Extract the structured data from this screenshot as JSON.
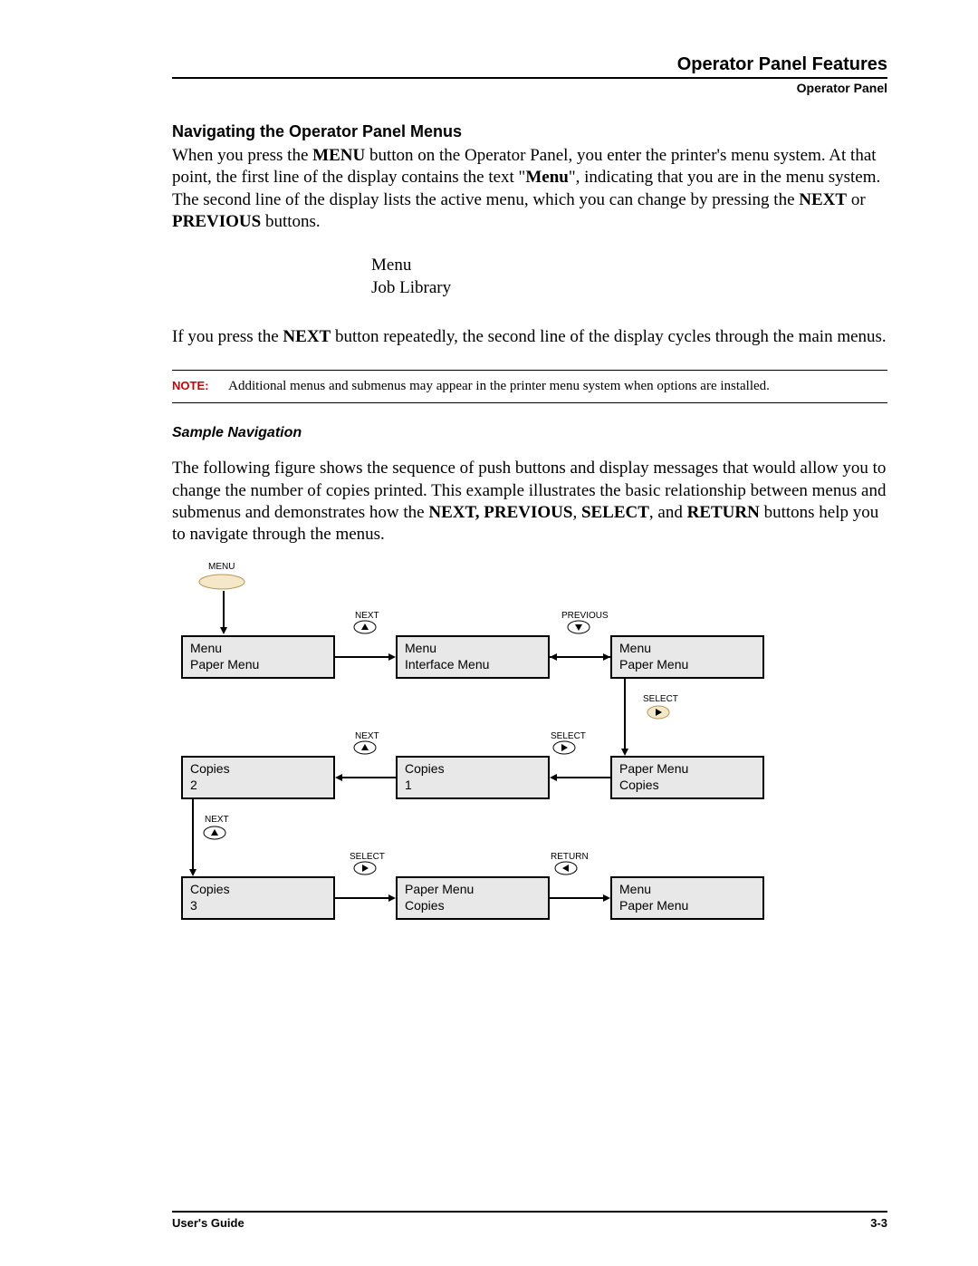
{
  "header": {
    "title": "Operator Panel Features",
    "subtitle": "Operator Panel"
  },
  "section": {
    "heading": "Navigating the Operator Panel Menus",
    "intro_html": "When you press the <b>MENU</b> button on the Operator Panel, you enter the printer's menu system. At that point, the first line of the display contains the text \"<b>Menu</b>\", indicating that you are in the menu system. The second line of the display lists the active menu, which you can change by pressing the <b>NEXT</b> or <b>PREVIOUS</b> buttons.",
    "display_line1": "Menu",
    "display_line2": "Job Library",
    "para2_html": "If you press the <b>NEXT</b> button repeatedly, the second line of the display cycles through the main menus.",
    "note_label": "NOTE:",
    "note_text": "Additional menus and submenus may appear in the printer menu system when options are installed.",
    "sub_heading": "Sample Navigation",
    "para3_html": "The following figure shows the sequence of push buttons and display messages that would allow you to change the number of copies printed. This example illustrates the basic relationship between menus and submenus and demonstrates how the <b>NEXT, PREVIOUS</b>, <b>SELECT</b>, and <b>RETURN</b> buttons help you to navigate through the menus."
  },
  "diagram": {
    "menu_label": "MENU",
    "boxes": {
      "b1": {
        "l1": "Menu",
        "l2": "Paper Menu"
      },
      "b2": {
        "l1": "Menu",
        "l2": "Interface Menu"
      },
      "b3": {
        "l1": "Menu",
        "l2": "Paper Menu"
      },
      "b4": {
        "l1": "Copies",
        "l2": "2"
      },
      "b5": {
        "l1": "Copies",
        "l2": "1"
      },
      "b6": {
        "l1": "Paper Menu",
        "l2": "Copies"
      },
      "b7": {
        "l1": "Copies",
        "l2": "3"
      },
      "b8": {
        "l1": "Paper Menu",
        "l2": "Copies"
      },
      "b9": {
        "l1": "Menu",
        "l2": "Paper Menu"
      }
    },
    "labels": {
      "next": "NEXT",
      "previous": "PREVIOUS",
      "select": "SELECT",
      "return": "RETURN"
    }
  },
  "footer": {
    "left": "User's Guide",
    "right": "3-3"
  }
}
